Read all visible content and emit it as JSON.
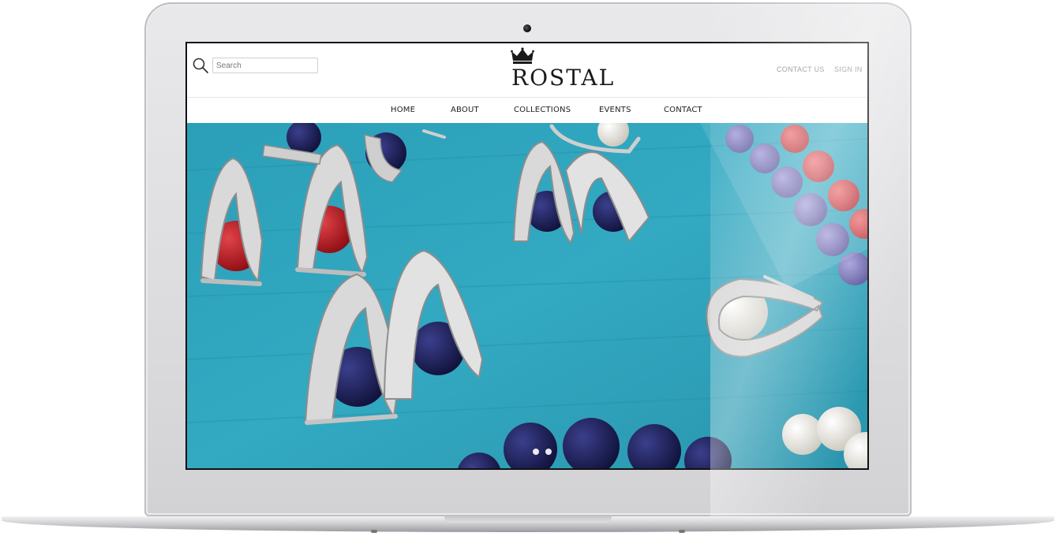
{
  "site": {
    "logo_text": "ROSTAL"
  },
  "search": {
    "placeholder": "Search",
    "value": ""
  },
  "header_links": {
    "contact_us": "CONTACT US",
    "sign_in": "SIGN IN"
  },
  "nav": {
    "items": [
      {
        "label": "HOME"
      },
      {
        "label": "ABOUT"
      },
      {
        "label": "COLLECTIONS"
      },
      {
        "label": "EVENTS"
      },
      {
        "label": "CONTACT"
      }
    ]
  },
  "hero": {
    "slide_count": 2,
    "icons": [
      "earring-image",
      "slider-dot"
    ]
  },
  "colors": {
    "hero_background": "#30a6bf",
    "bead_red": "#c0171f",
    "bead_navy": "#1b1f5c",
    "bead_purple": "#6e67b2",
    "pearl": "#f3f1ea",
    "silver": "#d8d8d8"
  }
}
